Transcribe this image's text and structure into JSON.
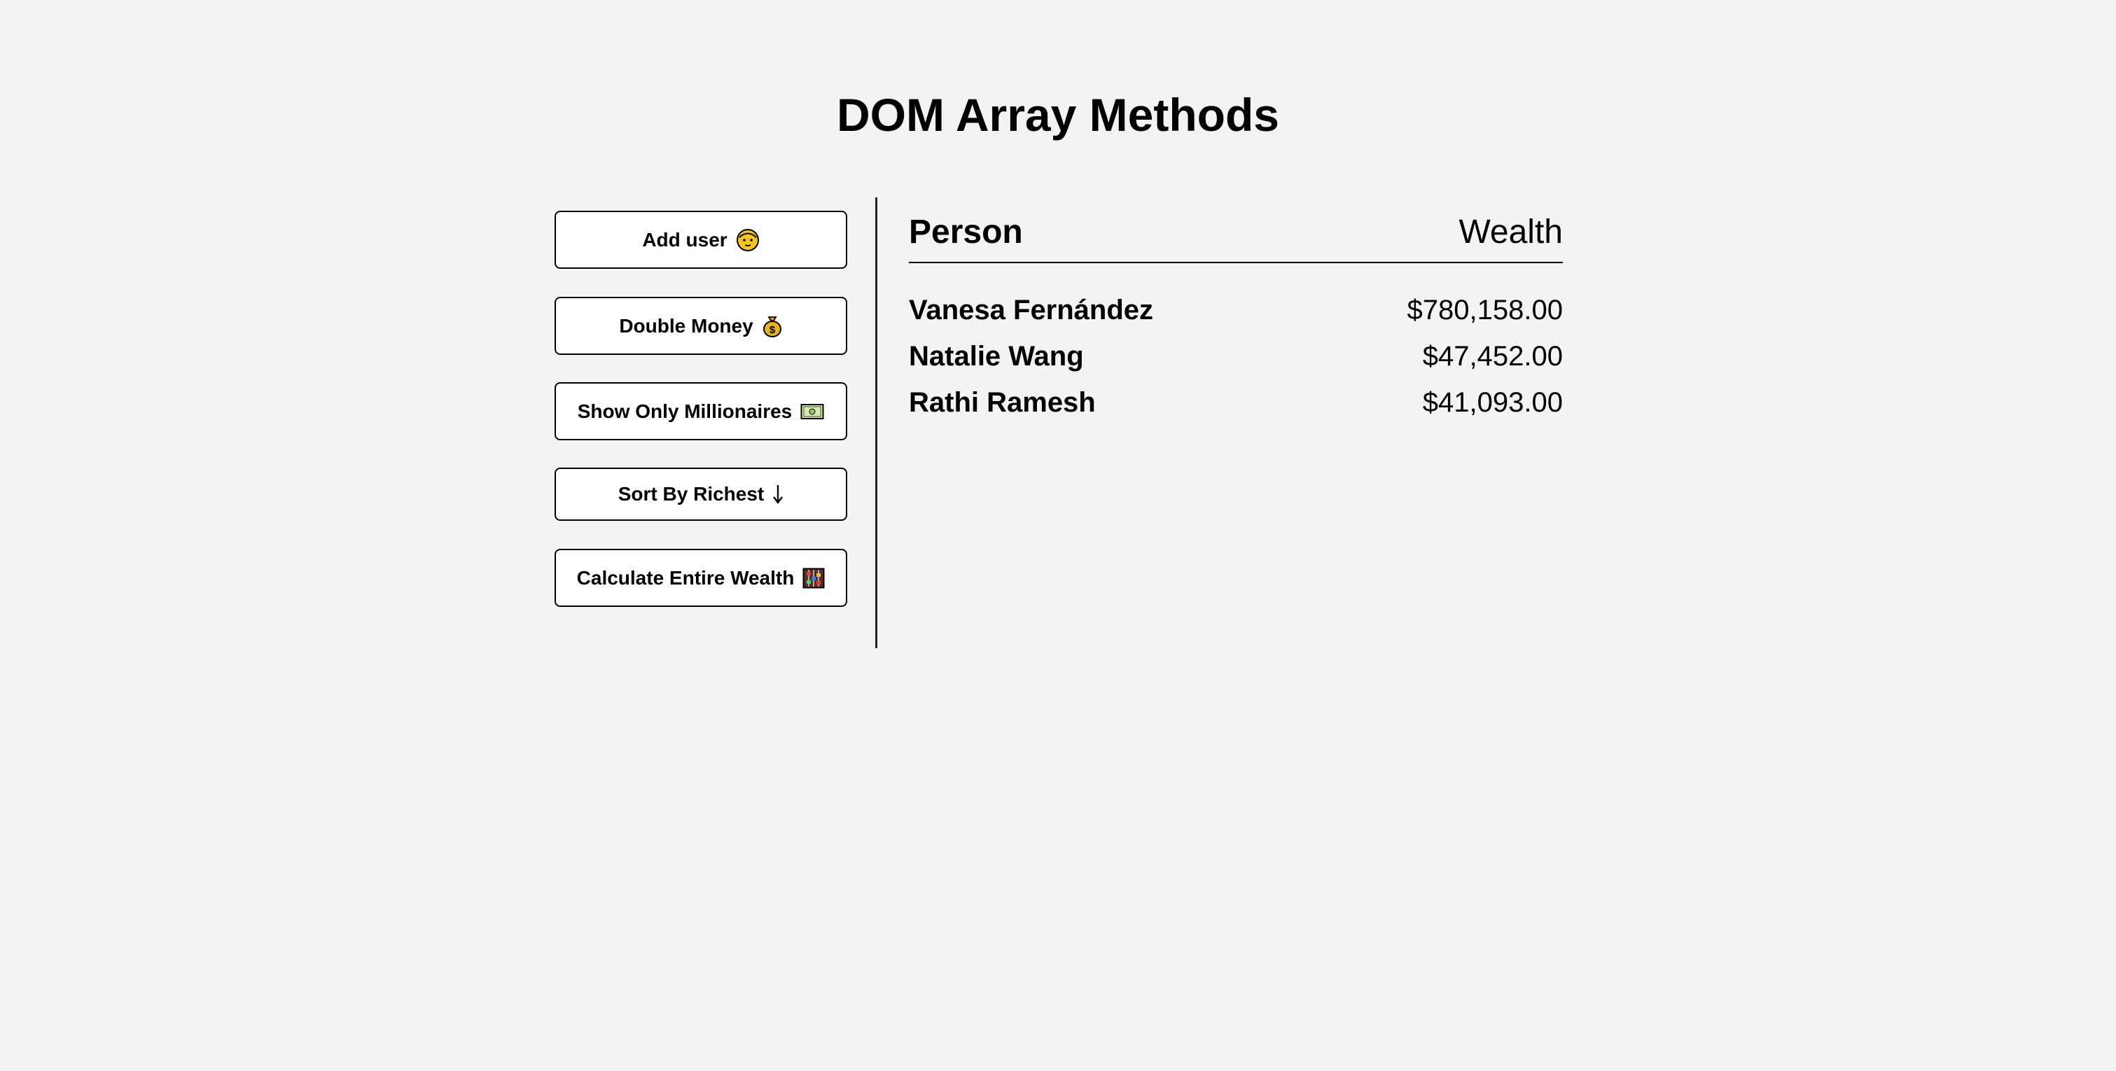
{
  "title": "DOM Array Methods",
  "buttons": {
    "add_user": "Add user",
    "double_money": "Double Money",
    "show_millionaires": "Show Only Millionaires",
    "sort_richest": "Sort By Richest",
    "calculate_wealth": "Calculate Entire Wealth"
  },
  "icons": {
    "add_user": "face-icon",
    "double_money": "money-bag-icon",
    "show_millionaires": "banknote-icon",
    "sort_richest": "arrow-down-icon",
    "calculate_wealth": "abacus-icon"
  },
  "table": {
    "header_person": "Person",
    "header_wealth": "Wealth",
    "rows": [
      {
        "name": "Vanesa Fernández",
        "wealth": "$780,158.00"
      },
      {
        "name": "Natalie Wang",
        "wealth": "$47,452.00"
      },
      {
        "name": "Rathi Ramesh",
        "wealth": "$41,093.00"
      }
    ]
  },
  "colors": {
    "background": "#f3f3f3",
    "button_bg": "#ffffff",
    "border": "#000000"
  }
}
